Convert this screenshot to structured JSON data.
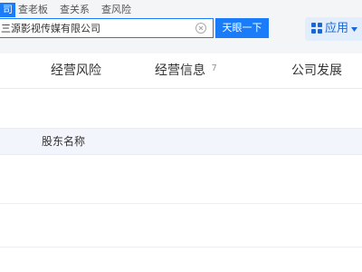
{
  "search": {
    "tabs": [
      "司",
      "查老板",
      "查关系",
      "查风险"
    ],
    "active_tab_index": 0,
    "query": "三源影视传媒有限公司",
    "button_label": "天眼一下"
  },
  "apps": {
    "label": "应用",
    "accent_color": "#1a66d6"
  },
  "nav": {
    "tabs": [
      {
        "label": "经营风险",
        "count": ""
      },
      {
        "label": "经营信息",
        "count": "7"
      },
      {
        "label": "公司发展",
        "count": ""
      }
    ]
  },
  "table": {
    "columns": [
      "股东名称"
    ]
  },
  "colors": {
    "primary": "#1a7cf8",
    "page_bg": "#f4f5f7",
    "table_header_bg": "#f2f5fb"
  }
}
